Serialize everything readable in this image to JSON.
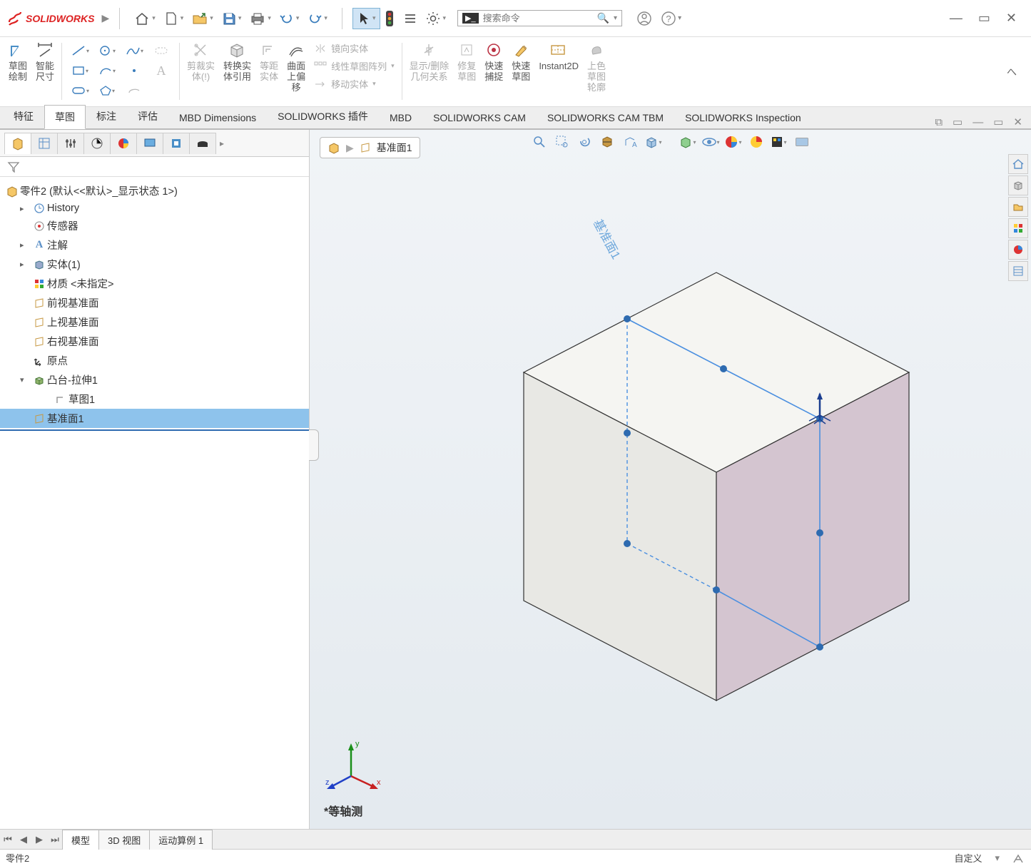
{
  "app": {
    "name": "SOLIDWORKS"
  },
  "search": {
    "placeholder": "搜索命令"
  },
  "ribbon": {
    "sketch": "草图\n绘制",
    "smartdim": "智能\n尺寸",
    "trim": "剪裁实\n体(!)",
    "convert": "转换实\n体引用",
    "offset_ent": "等距\n实体",
    "curve_offset": "曲面\n上偏\n移",
    "mirror": "镜向实体",
    "linear": "线性草图阵列",
    "move": "移动实体",
    "showrel": "显示/删除\n几何关系",
    "repair": "修复\n草图",
    "quick_snap": "快速\n捕捉",
    "quick_sketch": "快速\n草图",
    "instant2d": "Instant2D",
    "shade": "上色\n草图\n轮廓"
  },
  "tabs": [
    "特征",
    "草图",
    "标注",
    "评估",
    "MBD Dimensions",
    "SOLIDWORKS 插件",
    "MBD",
    "SOLIDWORKS CAM",
    "SOLIDWORKS CAM TBM",
    "SOLIDWORKS Inspection"
  ],
  "tree": {
    "root": "零件2  (默认<<默认>_显示状态 1>)",
    "history": "History",
    "sensors": "传感器",
    "annotations": "注解",
    "bodies": "实体(1)",
    "material": "材质 <未指定>",
    "front": "前视基准面",
    "top": "上视基准面",
    "right": "右视基准面",
    "origin": "原点",
    "extrude": "凸台-拉伸1",
    "sketch": "草图1",
    "plane1": "基准面1"
  },
  "breadcrumb": {
    "plane": "基准面1"
  },
  "plane_label": "基准面1",
  "view_label": "*等轴测",
  "bottom_tabs": [
    "模型",
    "3D 视图",
    "运动算例 1"
  ],
  "status": {
    "doc": "零件2",
    "right": "自定义"
  },
  "triad": {
    "x": "x",
    "y": "y",
    "z": "z"
  }
}
